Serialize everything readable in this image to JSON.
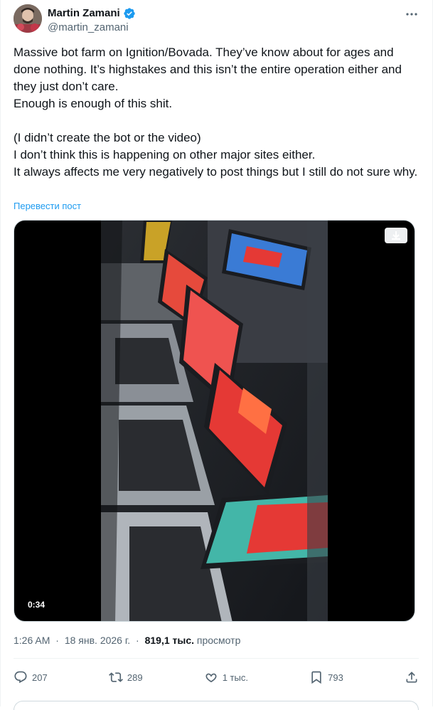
{
  "author": {
    "display_name": "Martin Zamani",
    "handle": "@martin_zamani"
  },
  "tweet": {
    "lines": [
      "Massive bot farm on Ignition/Bovada. They’ve know about for ages and done nothing. It’s highstakes and this isn’t the entire operation either and they just don’t care.",
      "Enough is enough of this shit.",
      "",
      "(I didn’t create the bot or the video)",
      "I don’t think this is happening on other major sites either.",
      "It always affects me very negatively to post things but I still do not sure why."
    ],
    "translate_label": "Перевести пост"
  },
  "media": {
    "duration": "0:34"
  },
  "meta": {
    "time": "1:26 AM",
    "separator": "·",
    "date": "18 янв. 2026 г.",
    "separator2": "·",
    "views_count": "819,1 тыс.",
    "views_label": "просмотр"
  },
  "actions": {
    "replies": "207",
    "reposts": "289",
    "likes": "1 тыс.",
    "bookmarks": "793"
  },
  "colors": {
    "accent": "#1d9bf0",
    "secondary_text": "#536471"
  }
}
